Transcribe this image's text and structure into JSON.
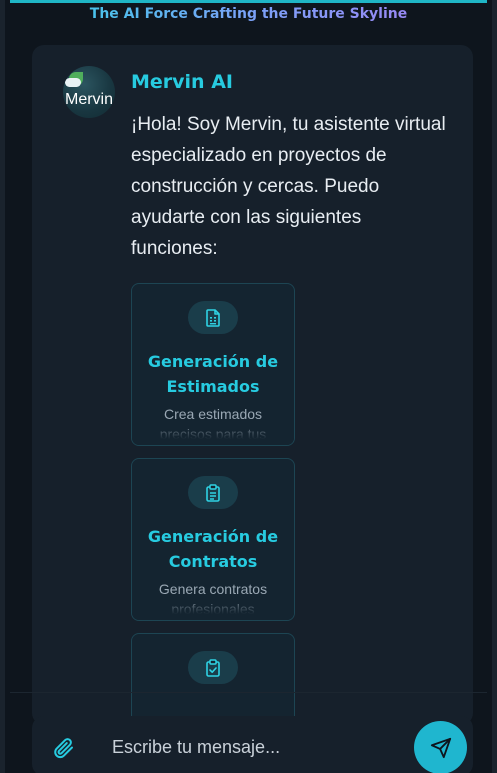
{
  "header": {
    "tagline": "The AI Force Crafting the Future Skyline"
  },
  "message": {
    "avatar_alt": "Mervin AI",
    "sender": "Mervin AI",
    "text": "¡Hola! Soy Mervin, tu asistente virtual especializado en proyectos de construcción y cercas. Puedo ayudarte con las siguientes funciones:"
  },
  "features": [
    {
      "icon": "document-icon",
      "title": "Generación de Estimados",
      "description": "Crea estimados precisos para tus proyectos"
    },
    {
      "icon": "clipboard-icon",
      "title": "Generación de Contratos",
      "description": "Genera contratos profesionales"
    },
    {
      "icon": "clipboard-check-icon",
      "title": "",
      "description": ""
    }
  ],
  "composer": {
    "placeholder": "Escribe tu mensaje...",
    "attach_icon": "paperclip-icon",
    "send_icon": "send-icon"
  },
  "colors": {
    "accent": "#27cbe0",
    "background": "#0e151d",
    "card": "#16202b",
    "send_button": "#1fb6cf"
  }
}
